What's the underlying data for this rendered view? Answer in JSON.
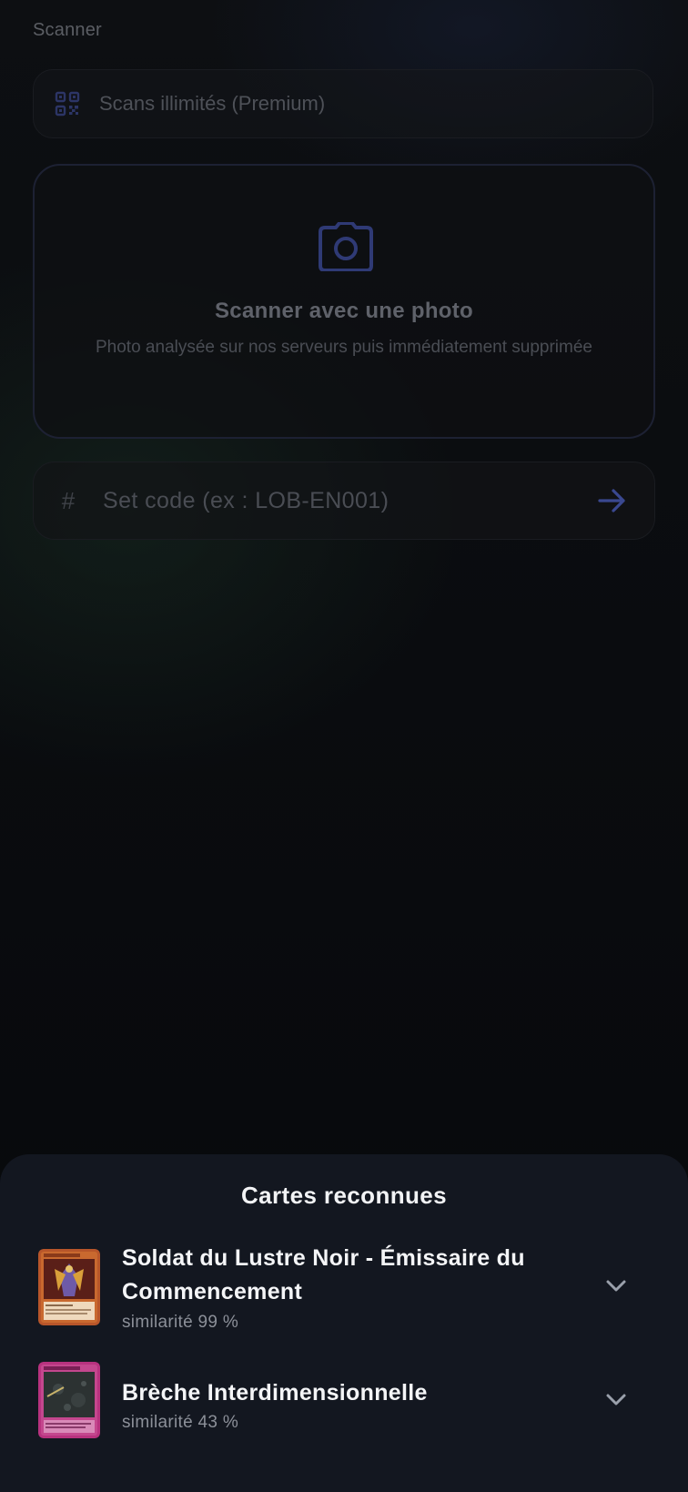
{
  "app": {
    "title": "Scanner"
  },
  "premium": {
    "label": "Scans illimités (Premium)",
    "icon": "qr-scan-icon"
  },
  "photo_scan": {
    "title": "Scanner avec une photo",
    "subtitle": "Photo analysée sur nos serveurs puis immédiatement supprimée",
    "icon": "camera-icon"
  },
  "set_code": {
    "prefix": "#",
    "placeholder": "Set code (ex : LOB-EN001)",
    "value": "",
    "submit_icon": "arrow-right-icon"
  },
  "results_sheet": {
    "title": "Cartes reconnues",
    "items": [
      {
        "name": "Soldat du Lustre Noir - Émissaire du Commencement",
        "similarity": "similarité 99 %",
        "thumb_icon": "card-thumbnail",
        "expand_icon": "chevron-down-icon"
      },
      {
        "name": "Brèche Interdimensionnelle",
        "similarity": "similarité 43 %",
        "thumb_icon": "card-thumbnail",
        "expand_icon": "chevron-down-icon"
      }
    ]
  },
  "colors": {
    "accent": "#3b4a8c",
    "sheet_bg": "#131720",
    "text_primary": "#f4f5f7",
    "text_secondary": "#8c9099"
  }
}
